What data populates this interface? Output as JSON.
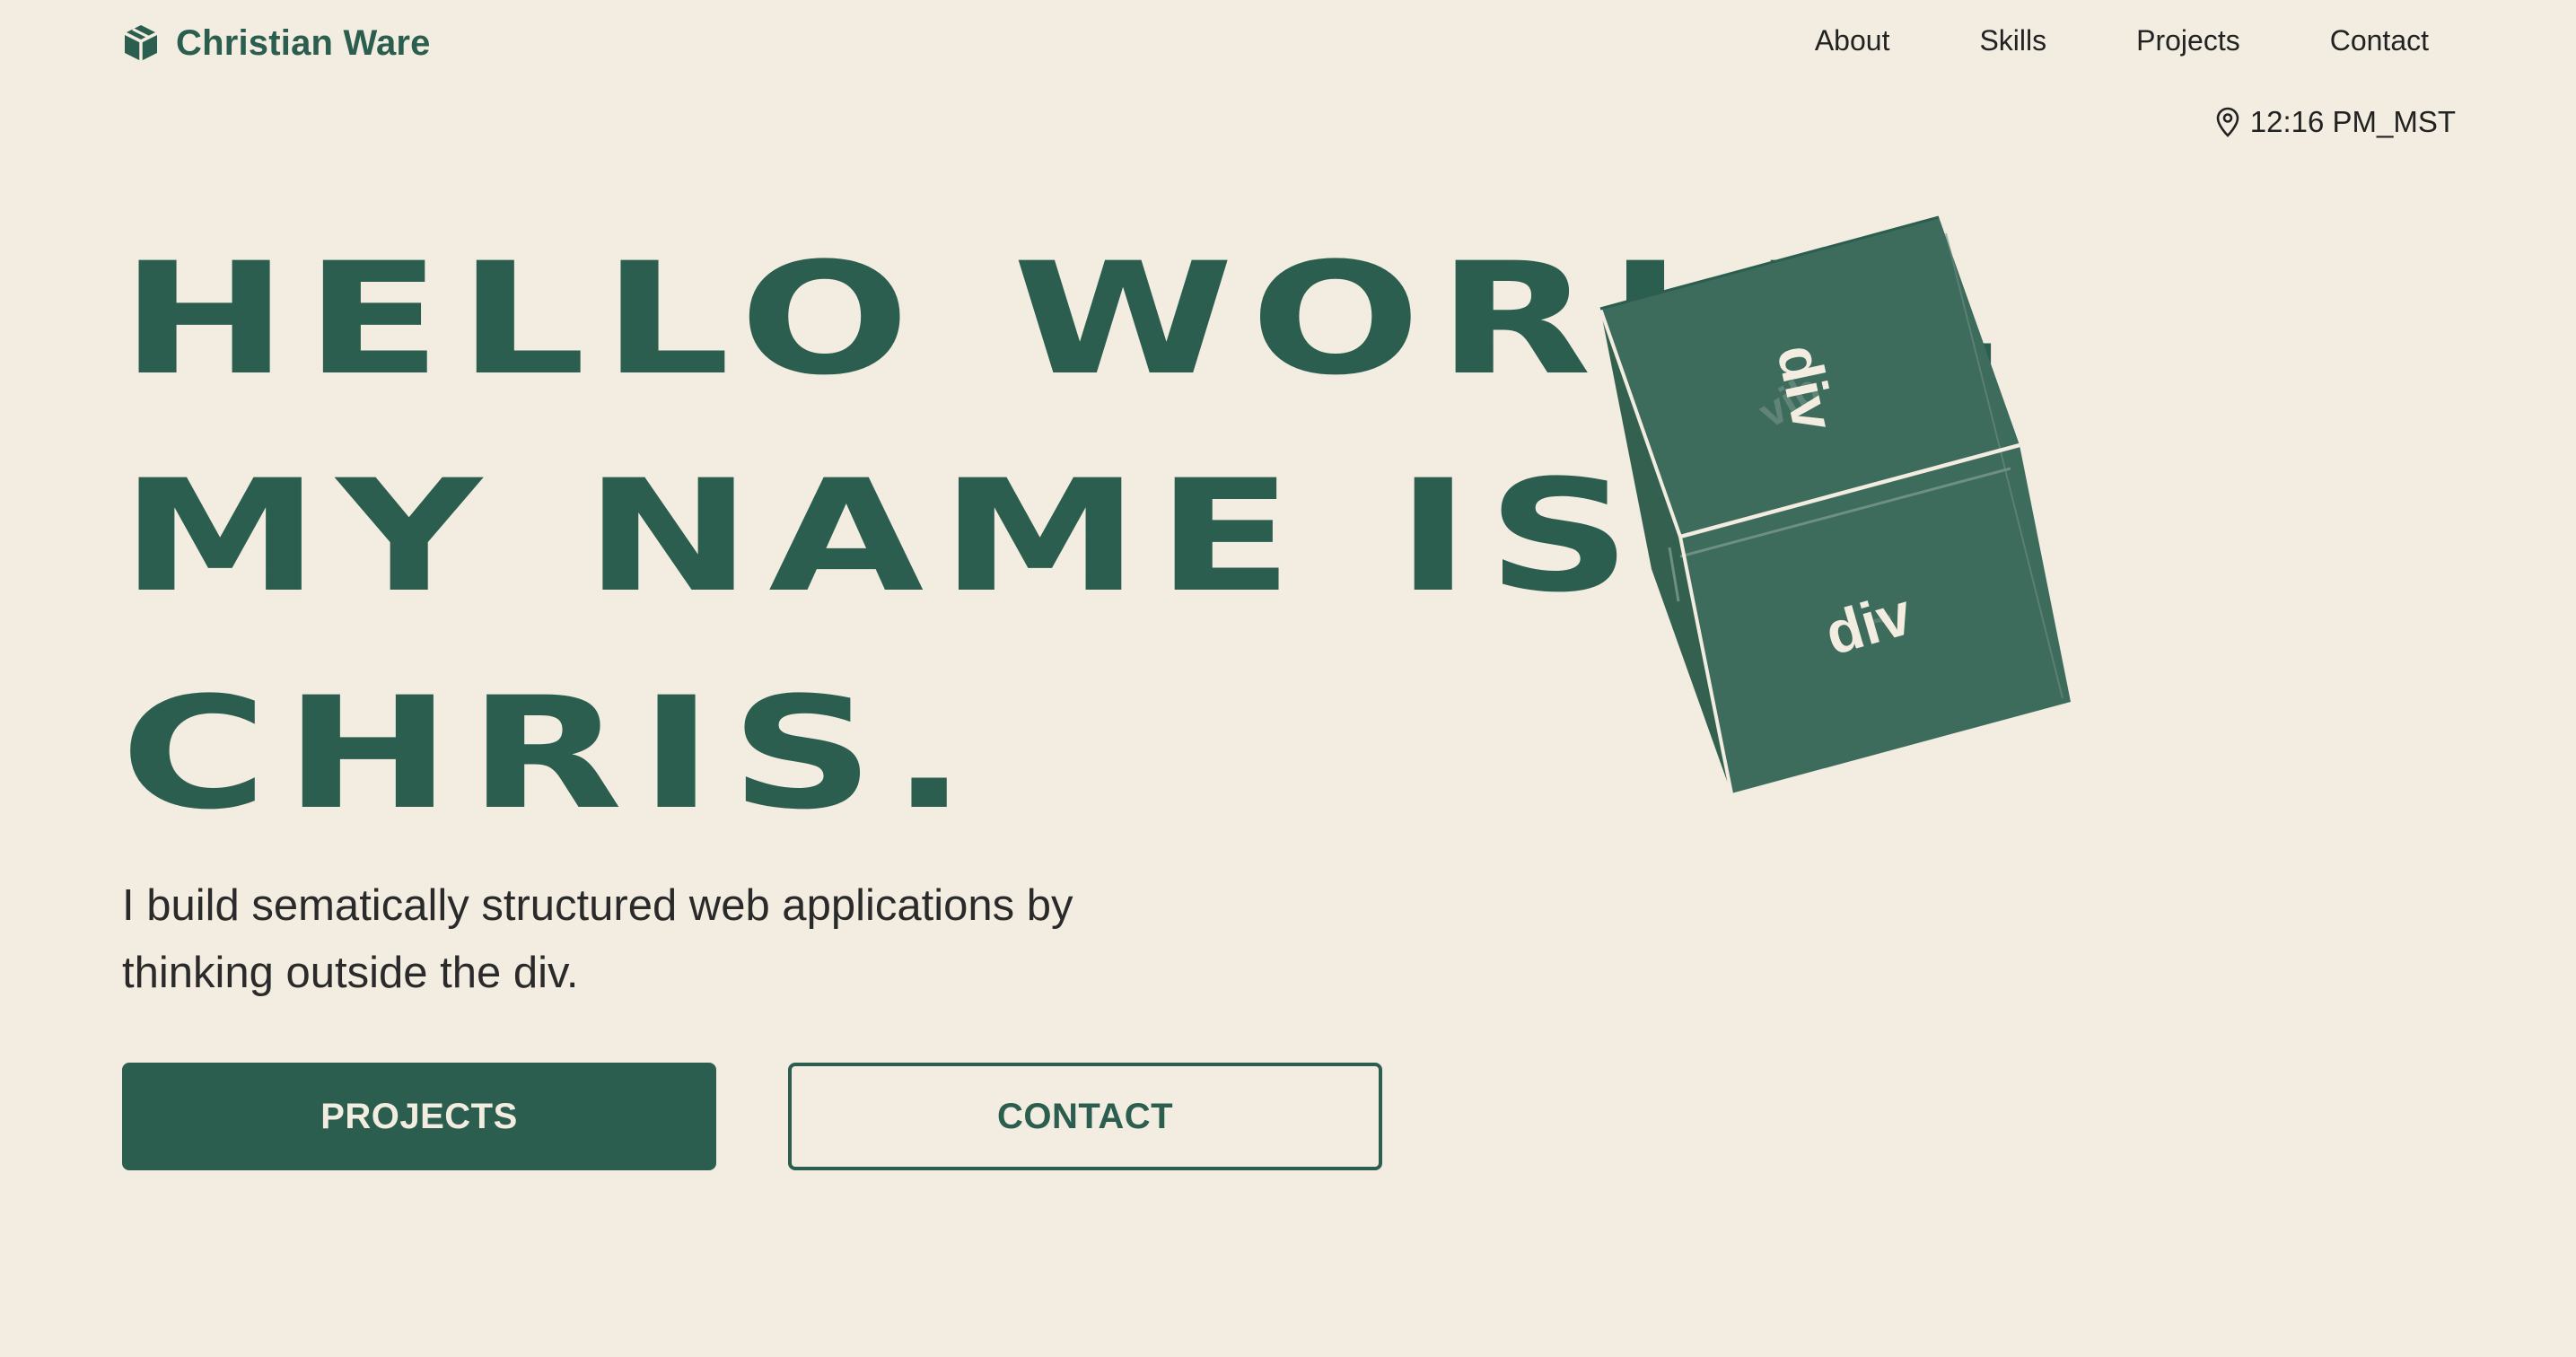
{
  "brand": {
    "name": "Christian Ware",
    "icon": "cube-icon"
  },
  "nav": {
    "items": [
      "About",
      "Skills",
      "Projects",
      "Contact"
    ]
  },
  "clock": {
    "icon": "location-pin-icon",
    "time": "12:16 PM_MST"
  },
  "hero": {
    "lines": [
      "HELLO WORLD.",
      "MY NAME IS",
      "CHRIS."
    ],
    "tagline": "I build sematically structured web applications by thinking outside the div."
  },
  "buttons": {
    "primary": "PROJECTS",
    "secondary": "CONTACT"
  },
  "cube": {
    "top_label": "div",
    "front_label": "div"
  },
  "colors": {
    "background": "#f2ede0",
    "accent": "#2b5e4f",
    "cube_face": "#3d6b5c",
    "text": "#2b2b2b"
  }
}
